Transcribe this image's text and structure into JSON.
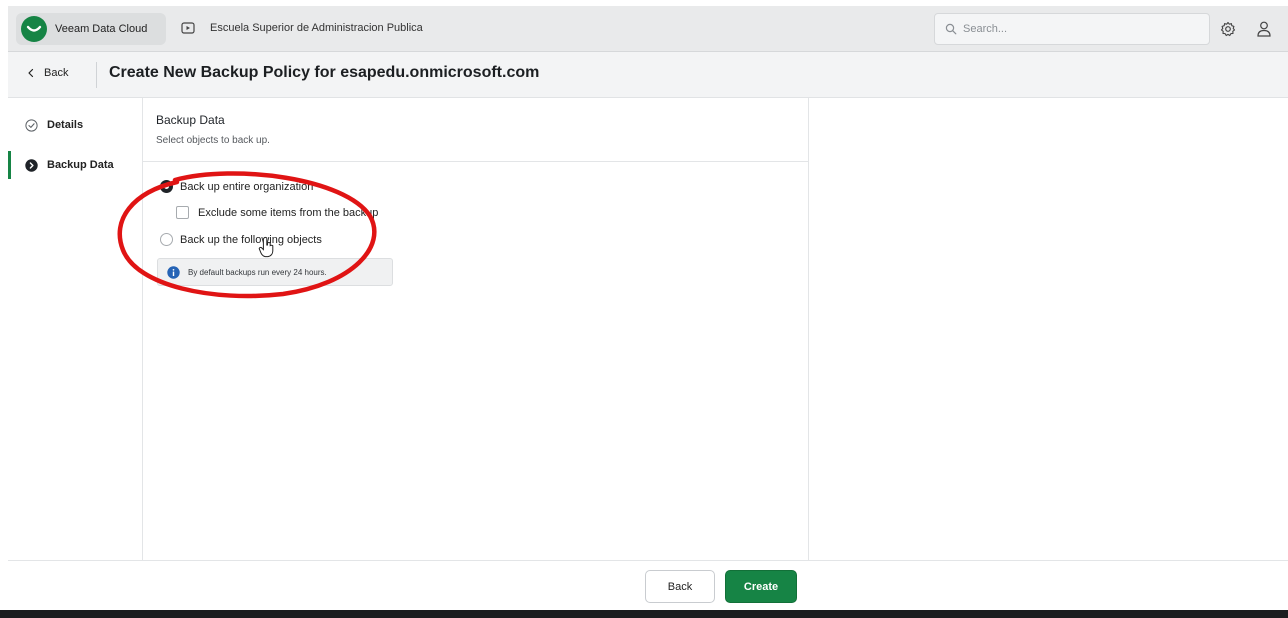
{
  "app": {
    "brand_name": "Veeam Data Cloud",
    "tenant_name": "Escuela Superior de Administracion Publica",
    "accent_color": "#168445"
  },
  "search": {
    "placeholder": "Search..."
  },
  "header": {
    "back_label": "Back",
    "title": "Create New Backup Policy for esapedu.onmicrosoft.com"
  },
  "steps": [
    {
      "label": "Details",
      "icon": "check-circle-icon",
      "state": "completed"
    },
    {
      "label": "Backup Data",
      "icon": "arrow-circle-icon",
      "state": "active"
    }
  ],
  "section": {
    "title": "Backup Data",
    "subtitle": "Select objects to back up."
  },
  "options": {
    "entire_org": {
      "label": "Back up entire organization",
      "selected": true
    },
    "exclude_items": {
      "label": "Exclude some items from the backup",
      "checked": false
    },
    "following_objects": {
      "label": "Back up the following objects",
      "selected": false
    }
  },
  "info": {
    "text": "By default backups run every 24 hours."
  },
  "footer": {
    "back_label": "Back",
    "create_label": "Create"
  }
}
